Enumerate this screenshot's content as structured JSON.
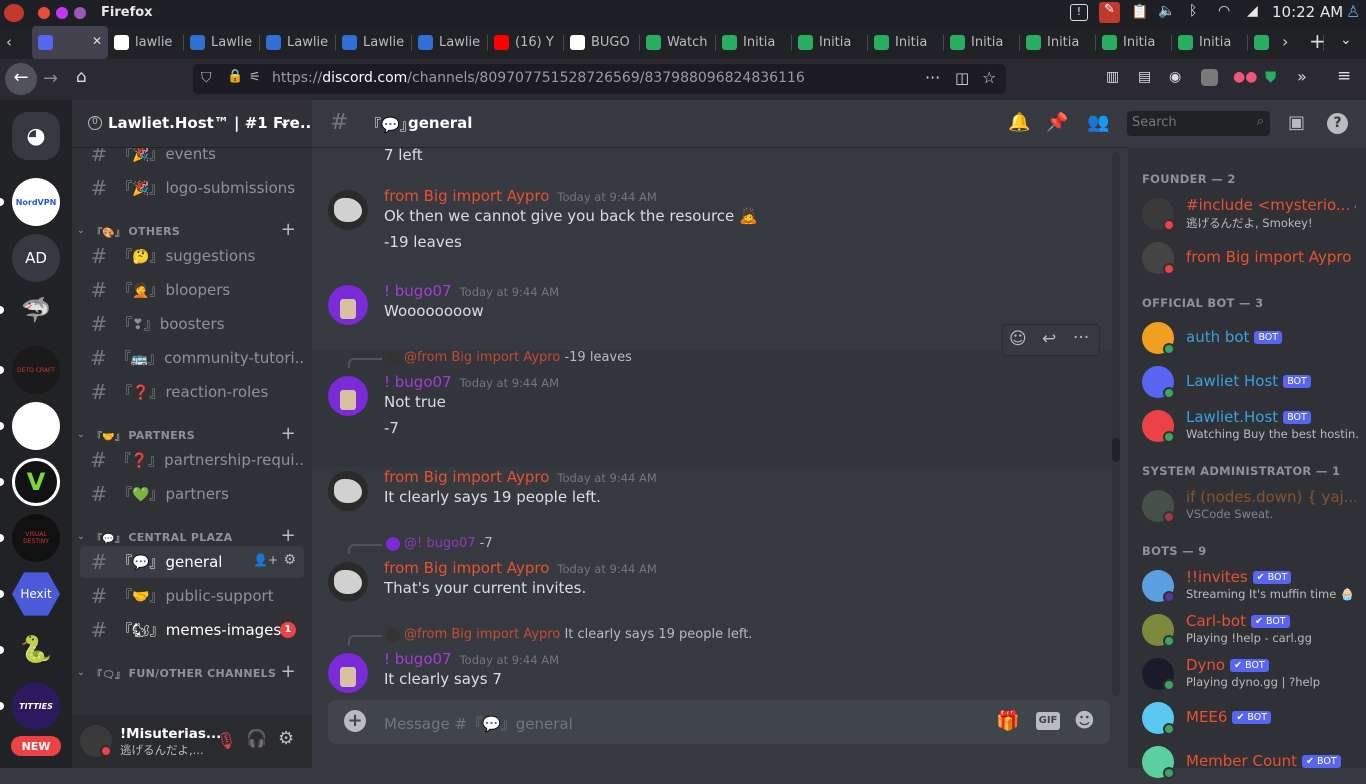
{
  "os": {
    "app_name": "Firefox",
    "clock": "10:22 AM"
  },
  "tabs": [
    {
      "label": "",
      "color": "#5865f2"
    },
    {
      "label": "lawlie",
      "color": "#ffffff"
    },
    {
      "label": "Lawlie",
      "color": "#2f6fd6"
    },
    {
      "label": "Lawlie",
      "color": "#2f6fd6"
    },
    {
      "label": "Lawlie",
      "color": "#2f6fd6"
    },
    {
      "label": "Lawlie",
      "color": "#2f6fd6"
    },
    {
      "label": "(16) Y",
      "color": "#ff0000"
    },
    {
      "label": "BUGO",
      "color": "#ffffff"
    },
    {
      "label": "Watch",
      "color": "#27ae60"
    },
    {
      "label": "Initia",
      "color": "#27ae60"
    },
    {
      "label": "Initia",
      "color": "#27ae60"
    },
    {
      "label": "Initia",
      "color": "#27ae60"
    },
    {
      "label": "Initia",
      "color": "#27ae60"
    },
    {
      "label": "Initia",
      "color": "#27ae60"
    },
    {
      "label": "Initia",
      "color": "#27ae60"
    },
    {
      "label": "Initia",
      "color": "#27ae60"
    },
    {
      "label": "",
      "color": "#27ae60"
    }
  ],
  "browser": {
    "url_prefix": "https://",
    "url_domain": "discord.com",
    "url_path": "/channels/809707751528726569/837988096824836116"
  },
  "guilds": [
    {
      "label": "",
      "icon": "discord-home-icon",
      "bg": "#36393f"
    },
    {
      "label": "NordVPN",
      "icon": "nordvpn-icon",
      "bg": "#ffffff"
    },
    {
      "label": "AD",
      "icon": "server-initials-icon",
      "bg": "#36393f"
    },
    {
      "label": "",
      "icon": "shark-icon",
      "bg": "#202225"
    },
    {
      "label": "DETO CRAFT",
      "icon": "detocraft-icon",
      "bg": "#1a1a1a"
    },
    {
      "label": "",
      "icon": "logo-sv-icon",
      "bg": "#ffffff"
    },
    {
      "label": "V",
      "icon": "logo-v-icon",
      "bg": "#111111"
    },
    {
      "label": "VISUAL DESTINY",
      "icon": "visual-destiny-icon",
      "bg": "#111111"
    },
    {
      "label": "Hexit",
      "icon": "hexit-icon",
      "bg": "#202225"
    },
    {
      "label": "",
      "icon": "red-snake-icon",
      "bg": "#202225"
    },
    {
      "label": "TITTIES",
      "icon": "purple-space-icon",
      "bg": "#2b1a5e"
    },
    {
      "label": "NEW",
      "icon": "new-badge",
      "bg": "#ed4245"
    }
  ],
  "server": {
    "name": "Lawliet.Host™ | #1 Fre...",
    "boost_count": "0"
  },
  "channels": [
    {
      "type": "channel",
      "emoji": "『🎉』",
      "name": "events",
      "unread": false
    },
    {
      "type": "channel",
      "emoji": "『🎉』",
      "name": "logo-submissions",
      "unread": false
    },
    {
      "type": "category",
      "emoji": "『🎨』",
      "name": "OTHERS"
    },
    {
      "type": "channel",
      "emoji": "『🤔』",
      "name": "suggestions",
      "unread": false
    },
    {
      "type": "channel",
      "emoji": "『🤦』",
      "name": "bloopers",
      "unread": false
    },
    {
      "type": "channel",
      "emoji": "『❣』",
      "name": "boosters",
      "unread": false
    },
    {
      "type": "channel",
      "emoji": "『🚌』",
      "name": "community-tutori...",
      "unread": false
    },
    {
      "type": "channel",
      "emoji": "『❓』",
      "name": "reaction-roles",
      "unread": false
    },
    {
      "type": "category",
      "emoji": "『🤝』",
      "name": "PARTNERS"
    },
    {
      "type": "channel",
      "emoji": "『❓』",
      "name": "partnership-requi...",
      "unread": false
    },
    {
      "type": "channel",
      "emoji": "『💚』",
      "name": "partners",
      "unread": false
    },
    {
      "type": "category",
      "emoji": "『💬』",
      "name": "CENTRAL PLAZA"
    },
    {
      "type": "channel",
      "emoji": "『💬』",
      "name": "general",
      "active": true
    },
    {
      "type": "channel",
      "emoji": "『🤝』",
      "name": "public-support",
      "unread": false
    },
    {
      "type": "channel",
      "emoji": "『🐿』",
      "name": "memes-images",
      "unread": true,
      "badge": "1"
    },
    {
      "type": "category",
      "emoji": "『🗨』",
      "name": "FUN/OTHER CHANNELS"
    }
  ],
  "user": {
    "name": "!Misuterias...",
    "status": "逃げるんだよ,..."
  },
  "chat_header": {
    "emoji": "『💬』",
    "name": "general",
    "search_placeholder": "Search"
  },
  "messages": [
    {
      "kind": "cont",
      "text": "7 left"
    },
    {
      "kind": "head",
      "author": "from Big import Aypro",
      "color": "#e8512f",
      "time": "Today at 9:44 AM",
      "avatar": "aypro",
      "lines": [
        "Ok then we cannot give you back the resource 🙇",
        "-19 leaves"
      ]
    },
    {
      "kind": "head",
      "author": "! bugo07",
      "color": "#a63ad6",
      "time": "Today at 9:44 AM",
      "avatar": "bugo",
      "lines": [
        "Woooooooow"
      ]
    },
    {
      "kind": "reply",
      "reply_author": "@from Big import Aypro",
      "reply_color": "#e8512f",
      "reply_text": "-19 leaves",
      "author": "! bugo07",
      "color": "#a63ad6",
      "time": "Today at 9:44 AM",
      "avatar": "bugo",
      "lines": [
        "Not true",
        "-7"
      ]
    },
    {
      "kind": "head",
      "author": "from Big import Aypro",
      "color": "#e8512f",
      "time": "Today at 9:44 AM",
      "avatar": "aypro",
      "lines": [
        "It clearly says 19 people left."
      ]
    },
    {
      "kind": "reply",
      "reply_author": "@! bugo07",
      "reply_color": "#a63ad6",
      "reply_text": "-7",
      "author": "from Big import Aypro",
      "color": "#e8512f",
      "time": "Today at 9:44 AM",
      "avatar": "aypro",
      "lines": [
        "That's your current invites."
      ]
    },
    {
      "kind": "reply",
      "reply_author": "@from Big import Aypro",
      "reply_color": "#e8512f",
      "reply_text": "It clearly says 19 people left.",
      "author": "! bugo07",
      "color": "#a63ad6",
      "time": "Today at 9:44 AM",
      "avatar": "bugo",
      "lines": [
        "It clearly says 7"
      ]
    }
  ],
  "composer": {
    "placeholder": "Message #『💬』general"
  },
  "members": [
    {
      "type": "header",
      "label": "FOUNDER — 2"
    },
    {
      "type": "member",
      "name": "#include <mysterio...",
      "color": "#e8512f",
      "sub": "逃げるんだよ, Smokey!",
      "status": "dnd",
      "avatar": "#3a3a3a",
      "badge": "◆"
    },
    {
      "type": "member",
      "name": "from Big import Aypro",
      "color": "#e8512f",
      "sub": "",
      "status": "dnd",
      "avatar": "#444444"
    },
    {
      "type": "header",
      "label": "OFFICIAL BOT — 3"
    },
    {
      "type": "member",
      "name": "auth bot",
      "color": "#3aa0e0",
      "sub": "",
      "status": "online",
      "avatar": "#f0a020",
      "bot": "BOT"
    },
    {
      "type": "member",
      "name": "Lawliet Host",
      "color": "#3aa0e0",
      "sub": "",
      "status": "online",
      "avatar": "#5865f2",
      "bot": "BOT"
    },
    {
      "type": "member",
      "name": "Lawliet.Host",
      "color": "#3aa0e0",
      "sub": "Watching Buy the best hostin...",
      "status": "online",
      "avatar": "#ed4245",
      "bot": "BOT"
    },
    {
      "type": "header",
      "label": "SYSTEM ADMINISTRATOR — 1"
    },
    {
      "type": "member",
      "name": "if (nodes.down) { yaj....",
      "color": "#c06a2a",
      "sub": "VSCode Sweat.",
      "status": "dnd",
      "avatar": "#556655",
      "dim": true
    },
    {
      "type": "header",
      "label": "BOTS — 9"
    },
    {
      "type": "member",
      "name": "!!invites",
      "color": "#e8512f",
      "sub": "Streaming It's muffin time 🧁",
      "status": "streaming",
      "avatar": "#5aa0e0",
      "bot": "✔ BOT"
    },
    {
      "type": "member",
      "name": "Carl-bot",
      "color": "#e8512f",
      "sub": "Playing !help - carl.gg",
      "status": "online",
      "avatar": "#7a8a3a",
      "bot": "✔ BOT"
    },
    {
      "type": "member",
      "name": "Dyno",
      "color": "#e8512f",
      "sub": "Playing dyno.gg | ?help",
      "status": "online",
      "avatar": "#1a1a2a",
      "bot": "✔ BOT"
    },
    {
      "type": "member",
      "name": "MEE6",
      "color": "#e8512f",
      "sub": "",
      "status": "online",
      "avatar": "#5ac8f0",
      "bot": "✔ BOT"
    },
    {
      "type": "member",
      "name": "Member Count",
      "color": "#e8512f",
      "sub": "",
      "status": "online",
      "avatar": "#5ad0a0",
      "bot": "✔ BOT"
    }
  ]
}
